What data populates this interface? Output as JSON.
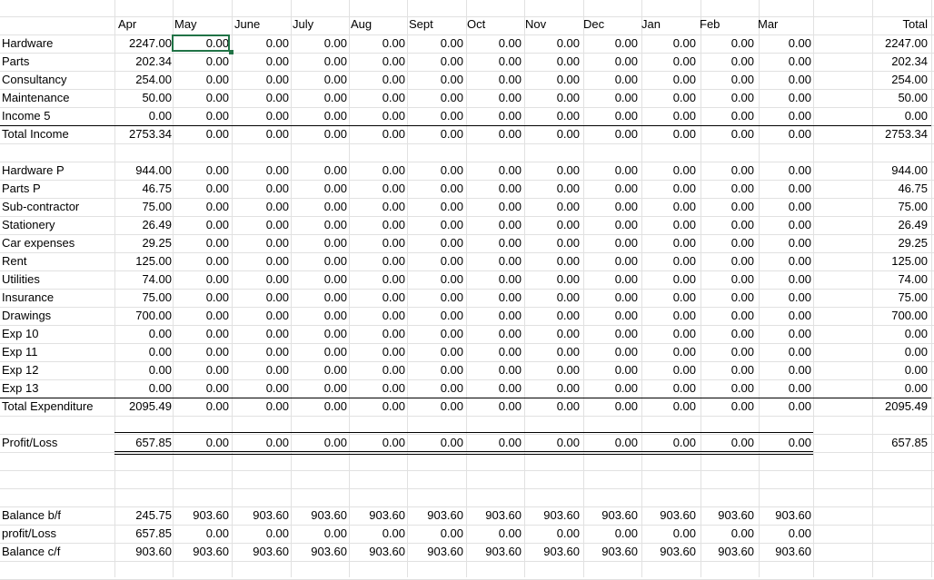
{
  "months": [
    "Apr",
    "May",
    "June",
    "July",
    "Aug",
    "Sept",
    "Oct",
    "Nov",
    "Dec",
    "Jan",
    "Feb",
    "Mar"
  ],
  "total_header": "Total",
  "income": [
    {
      "label": "Hardware",
      "values": [
        "2247.00",
        "0.00",
        "0.00",
        "0.00",
        "0.00",
        "0.00",
        "0.00",
        "0.00",
        "0.00",
        "0.00",
        "0.00",
        "0.00"
      ],
      "total": "2247.00"
    },
    {
      "label": "Parts",
      "values": [
        "202.34",
        "0.00",
        "0.00",
        "0.00",
        "0.00",
        "0.00",
        "0.00",
        "0.00",
        "0.00",
        "0.00",
        "0.00",
        "0.00"
      ],
      "total": "202.34"
    },
    {
      "label": "Consultancy",
      "values": [
        "254.00",
        "0.00",
        "0.00",
        "0.00",
        "0.00",
        "0.00",
        "0.00",
        "0.00",
        "0.00",
        "0.00",
        "0.00",
        "0.00"
      ],
      "total": "254.00"
    },
    {
      "label": "Maintenance",
      "values": [
        "50.00",
        "0.00",
        "0.00",
        "0.00",
        "0.00",
        "0.00",
        "0.00",
        "0.00",
        "0.00",
        "0.00",
        "0.00",
        "0.00"
      ],
      "total": "50.00"
    },
    {
      "label": "Income 5",
      "values": [
        "0.00",
        "0.00",
        "0.00",
        "0.00",
        "0.00",
        "0.00",
        "0.00",
        "0.00",
        "0.00",
        "0.00",
        "0.00",
        "0.00"
      ],
      "total": "0.00"
    }
  ],
  "total_income": {
    "label": "Total Income",
    "values": [
      "2753.34",
      "0.00",
      "0.00",
      "0.00",
      "0.00",
      "0.00",
      "0.00",
      "0.00",
      "0.00",
      "0.00",
      "0.00",
      "0.00"
    ],
    "total": "2753.34"
  },
  "expenditure": [
    {
      "label": "Hardware P",
      "values": [
        "944.00",
        "0.00",
        "0.00",
        "0.00",
        "0.00",
        "0.00",
        "0.00",
        "0.00",
        "0.00",
        "0.00",
        "0.00",
        "0.00"
      ],
      "total": "944.00"
    },
    {
      "label": "Parts P",
      "values": [
        "46.75",
        "0.00",
        "0.00",
        "0.00",
        "0.00",
        "0.00",
        "0.00",
        "0.00",
        "0.00",
        "0.00",
        "0.00",
        "0.00"
      ],
      "total": "46.75"
    },
    {
      "label": "Sub-contractor",
      "values": [
        "75.00",
        "0.00",
        "0.00",
        "0.00",
        "0.00",
        "0.00",
        "0.00",
        "0.00",
        "0.00",
        "0.00",
        "0.00",
        "0.00"
      ],
      "total": "75.00"
    },
    {
      "label": "Stationery",
      "values": [
        "26.49",
        "0.00",
        "0.00",
        "0.00",
        "0.00",
        "0.00",
        "0.00",
        "0.00",
        "0.00",
        "0.00",
        "0.00",
        "0.00"
      ],
      "total": "26.49"
    },
    {
      "label": "Car expenses",
      "values": [
        "29.25",
        "0.00",
        "0.00",
        "0.00",
        "0.00",
        "0.00",
        "0.00",
        "0.00",
        "0.00",
        "0.00",
        "0.00",
        "0.00"
      ],
      "total": "29.25"
    },
    {
      "label": "Rent",
      "values": [
        "125.00",
        "0.00",
        "0.00",
        "0.00",
        "0.00",
        "0.00",
        "0.00",
        "0.00",
        "0.00",
        "0.00",
        "0.00",
        "0.00"
      ],
      "total": "125.00"
    },
    {
      "label": "Utilities",
      "values": [
        "74.00",
        "0.00",
        "0.00",
        "0.00",
        "0.00",
        "0.00",
        "0.00",
        "0.00",
        "0.00",
        "0.00",
        "0.00",
        "0.00"
      ],
      "total": "74.00"
    },
    {
      "label": "Insurance",
      "values": [
        "75.00",
        "0.00",
        "0.00",
        "0.00",
        "0.00",
        "0.00",
        "0.00",
        "0.00",
        "0.00",
        "0.00",
        "0.00",
        "0.00"
      ],
      "total": "75.00"
    },
    {
      "label": "Drawings",
      "values": [
        "700.00",
        "0.00",
        "0.00",
        "0.00",
        "0.00",
        "0.00",
        "0.00",
        "0.00",
        "0.00",
        "0.00",
        "0.00",
        "0.00"
      ],
      "total": "700.00"
    },
    {
      "label": "Exp 10",
      "values": [
        "0.00",
        "0.00",
        "0.00",
        "0.00",
        "0.00",
        "0.00",
        "0.00",
        "0.00",
        "0.00",
        "0.00",
        "0.00",
        "0.00"
      ],
      "total": "0.00"
    },
    {
      "label": "Exp 11",
      "values": [
        "0.00",
        "0.00",
        "0.00",
        "0.00",
        "0.00",
        "0.00",
        "0.00",
        "0.00",
        "0.00",
        "0.00",
        "0.00",
        "0.00"
      ],
      "total": "0.00"
    },
    {
      "label": "Exp 12",
      "values": [
        "0.00",
        "0.00",
        "0.00",
        "0.00",
        "0.00",
        "0.00",
        "0.00",
        "0.00",
        "0.00",
        "0.00",
        "0.00",
        "0.00"
      ],
      "total": "0.00"
    },
    {
      "label": "Exp 13",
      "values": [
        "0.00",
        "0.00",
        "0.00",
        "0.00",
        "0.00",
        "0.00",
        "0.00",
        "0.00",
        "0.00",
        "0.00",
        "0.00",
        "0.00"
      ],
      "total": "0.00"
    }
  ],
  "total_expenditure": {
    "label": "Total Expenditure",
    "values": [
      "2095.49",
      "0.00",
      "0.00",
      "0.00",
      "0.00",
      "0.00",
      "0.00",
      "0.00",
      "0.00",
      "0.00",
      "0.00",
      "0.00"
    ],
    "total": "2095.49"
  },
  "profit_loss": {
    "label": "Profit/Loss",
    "values": [
      "657.85",
      "0.00",
      "0.00",
      "0.00",
      "0.00",
      "0.00",
      "0.00",
      "0.00",
      "0.00",
      "0.00",
      "0.00",
      "0.00"
    ],
    "total": "657.85"
  },
  "balance": [
    {
      "label": "Balance b/f",
      "values": [
        "245.75",
        "903.60",
        "903.60",
        "903.60",
        "903.60",
        "903.60",
        "903.60",
        "903.60",
        "903.60",
        "903.60",
        "903.60",
        "903.60"
      ]
    },
    {
      "label": "profit/Loss",
      "values": [
        "657.85",
        "0.00",
        "0.00",
        "0.00",
        "0.00",
        "0.00",
        "0.00",
        "0.00",
        "0.00",
        "0.00",
        "0.00",
        "0.00"
      ]
    },
    {
      "label": "Balance c/f",
      "values": [
        "903.60",
        "903.60",
        "903.60",
        "903.60",
        "903.60",
        "903.60",
        "903.60",
        "903.60",
        "903.60",
        "903.60",
        "903.60",
        "903.60"
      ]
    }
  ]
}
